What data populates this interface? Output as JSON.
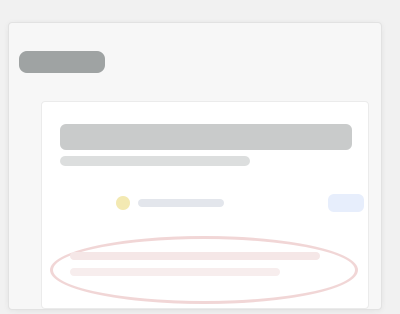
{
  "window": {
    "title": ""
  },
  "panel": {
    "heading": "",
    "subheading": ""
  },
  "toolbar": {
    "status_label": "",
    "action_label": ""
  },
  "highlight": {
    "line_1": "",
    "line_2": ""
  },
  "colors": {
    "background": "#f1f1f1",
    "accent_blue": "#e7eefc",
    "accent_yellow": "#f3e9b2",
    "highlight_red": "#f1d6d6"
  },
  "icons": {
    "status": "status-dot-icon"
  }
}
